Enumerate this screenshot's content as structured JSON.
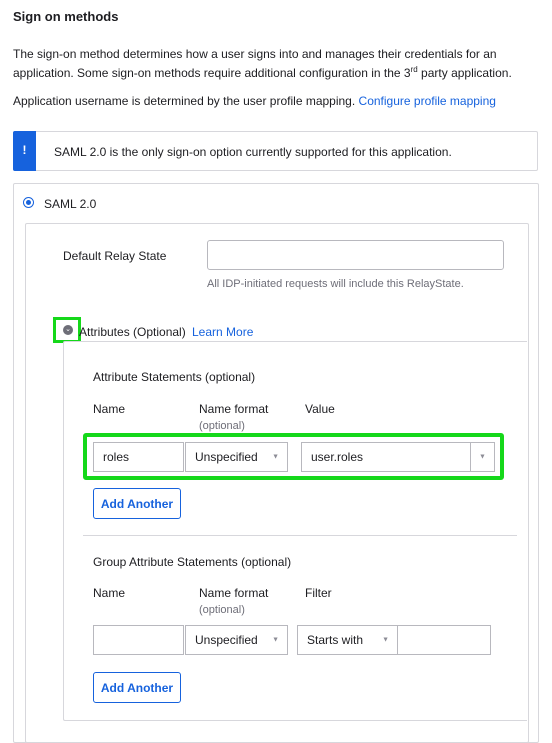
{
  "section": {
    "title": "Sign on methods",
    "description_part1": "The sign-on method determines how a user signs into and manages their credentials for an application. Some sign-on methods require additional configuration in the 3",
    "description_sup": "rd",
    "description_part2": " party application.",
    "username_text": "Application username is determined by the user profile mapping.",
    "username_link": "Configure profile mapping"
  },
  "banner": {
    "icon": "info-icon",
    "glyph": "!",
    "text": "SAML 2.0 is the only sign-on option currently supported for this application."
  },
  "method": {
    "radio_label": "SAML 2.0",
    "selected": true
  },
  "relay": {
    "label": "Default Relay State",
    "value": "",
    "help": "All IDP-initiated requests will include this RelayState."
  },
  "attributes": {
    "toggle_icon": "chevron-down-icon",
    "toggle_glyph": "⌄",
    "label": "Attributes (Optional)",
    "learn_more": "Learn More",
    "statements": {
      "title": "Attribute Statements (optional)",
      "col_name": "Name",
      "col_format": "Name format",
      "col_format_sub": "(optional)",
      "col_value": "Value",
      "row": {
        "name": "roles",
        "format": "Unspecified",
        "value": "user.roles"
      },
      "add_label": "Add Another"
    },
    "group_statements": {
      "title": "Group Attribute Statements (optional)",
      "col_name": "Name",
      "col_format": "Name format",
      "col_format_sub": "(optional)",
      "col_filter": "Filter",
      "row": {
        "name": "",
        "format": "Unspecified",
        "filter_type": "Starts with",
        "filter_value": ""
      },
      "add_label": "Add Another"
    }
  },
  "colors": {
    "accent": "#1662dd",
    "highlight": "#15d81a",
    "border": "#d7d7dc"
  }
}
